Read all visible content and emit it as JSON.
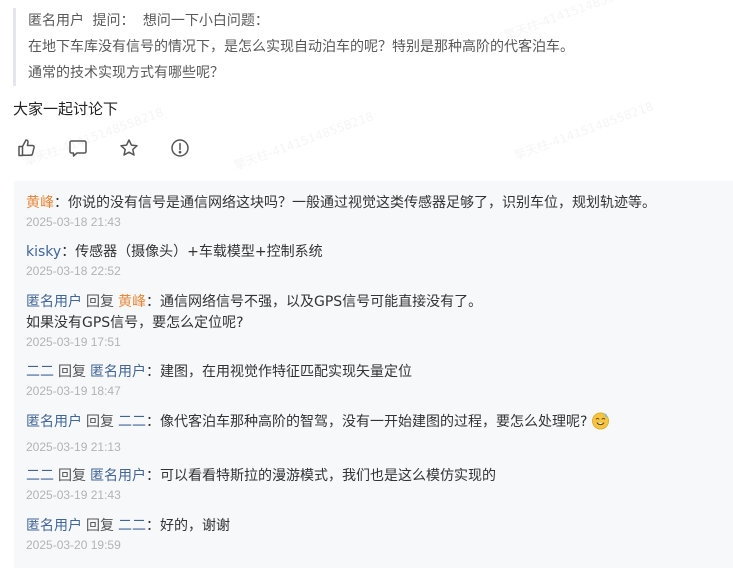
{
  "quote": {
    "author": "匿名用户",
    "ask_label": "提问：",
    "title": "想问一下小白问题：",
    "line1": "在地下车库没有信号的情况下，是怎么实现自动泊车的呢？特别是那种高阶的代客泊车。",
    "line2": "通常的技术实现方式有哪些呢？"
  },
  "main_text": "大家一起讨论下",
  "actions": [
    "like-icon",
    "comment-icon",
    "star-icon",
    "report-icon"
  ],
  "watermarks": [
    "擎天柱-41415148558218",
    "擎天柱-41415148558218",
    "擎天柱-41415148558218",
    "擎天柱-41415148558218"
  ],
  "comments": [
    {
      "author": "黄峰",
      "reply_to": "",
      "text": "：你说的没有信号是通信网络这块吗？一般通过视觉这类传感器足够了，识别车位，规划轨迹等。",
      "text2": "",
      "time": "2025-03-18 21:43"
    },
    {
      "author": "kisky",
      "reply_to": "",
      "text": "：传感器（摄像头）+车载模型+控制系统",
      "text2": "",
      "time": "2025-03-18 22:52"
    },
    {
      "author": "匿名用户",
      "reply_word": "回复",
      "reply_to": "黄峰",
      "text": "：通信网络信号不强，以及GPS信号可能直接没有了。",
      "text2": "如果没有GPS信号，要怎么定位呢?",
      "time": "2025-03-19 17:51"
    },
    {
      "author": "二二",
      "reply_word": "回复",
      "reply_to": "匿名用户",
      "text": "：建图，在用视觉作特征匹配实现矢量定位",
      "text2": "",
      "time": "2025-03-19 18:47"
    },
    {
      "author": "匿名用户",
      "reply_word": "回复",
      "reply_to": "二二",
      "text": "：像代客泊车那种高阶的智驾，没有一开始建图的过程，要怎么处理呢?",
      "text2": "",
      "time": "2025-03-19 21:13",
      "emoji": "sweat-smile-emoji"
    },
    {
      "author": "二二",
      "reply_word": "回复",
      "reply_to": "匿名用户",
      "text": "：可以看看特斯拉的漫游模式，我们也是这么模仿实现的",
      "text2": "",
      "time": "2025-03-19 21:43"
    },
    {
      "author": "匿名用户",
      "reply_word": "回复",
      "reply_to": "二二",
      "text": "：好的，谢谢",
      "text2": "",
      "time": "2025-03-20 19:59"
    }
  ],
  "colors": {
    "author_link": "#406599",
    "author_highlight": "#e5883c",
    "time": "#b3b3b3",
    "panel_bg": "#f7f8fa"
  }
}
